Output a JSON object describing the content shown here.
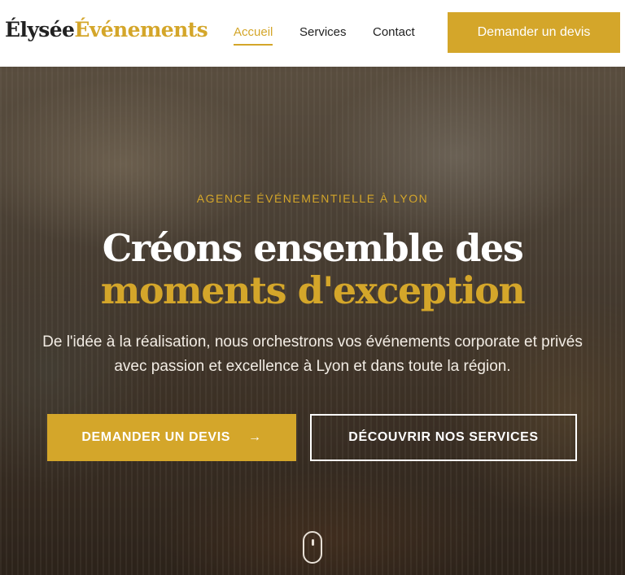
{
  "header": {
    "logo_part1": "Élysée",
    "logo_part2": "Événements",
    "nav": [
      {
        "label": "Accueil",
        "active": true
      },
      {
        "label": "Services",
        "active": false
      },
      {
        "label": "Contact",
        "active": false
      }
    ],
    "cta_label": "Demander un devis"
  },
  "hero": {
    "kicker": "AGENCE ÉVÉNEMENTIELLE À LYON",
    "title_line1": "Créons ensemble des",
    "title_line2": "moments d'exception",
    "lead": "De l'idée à la réalisation, nous orchestrons vos événements corporate et privés avec passion et excellence à Lyon et dans toute la région.",
    "primary_cta": "DEMANDER UN DEVIS",
    "primary_cta_icon": "arrow-right-icon",
    "secondary_cta": "DÉCOUVRIR NOS SERVICES"
  },
  "colors": {
    "accent": "#d4a62a",
    "text_dark": "#222222",
    "white": "#ffffff"
  }
}
